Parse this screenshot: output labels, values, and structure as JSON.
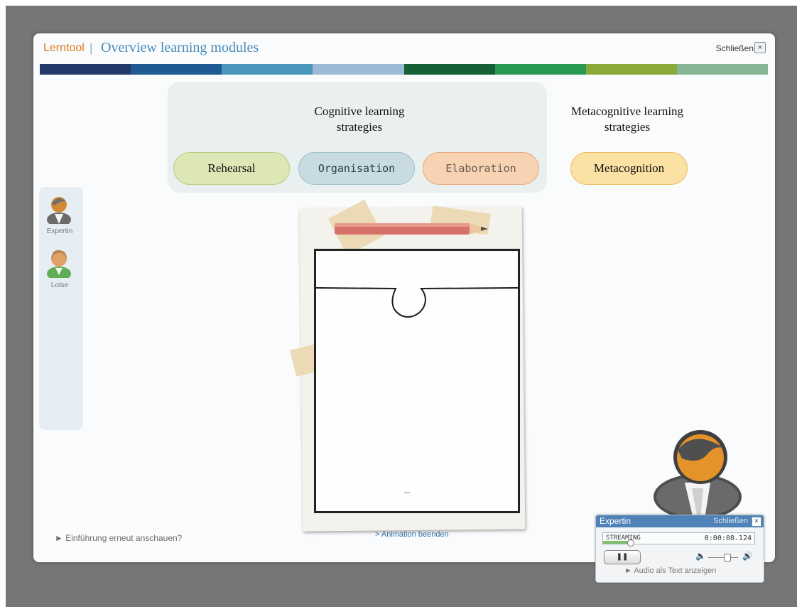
{
  "window": {
    "app_name": "Lerntool",
    "separator": "|",
    "title": "Overview learning modules",
    "close_label": "Schließen",
    "close_icon": "×"
  },
  "color_bar": [
    "#233a68",
    "#1f5a94",
    "#4a97bb",
    "#9abad8",
    "#175f35",
    "#2a9a53",
    "#8aa93a",
    "#86b594"
  ],
  "strategies": {
    "cognitive_heading": "Cognitive learning strategies",
    "metacognitive_heading": "Metacognitive learning strategies",
    "modules": [
      {
        "label": "Rehearsal",
        "color": "#dde7b6",
        "border": "#b9cc80",
        "text_color": "#111111"
      },
      {
        "label": "Organisation",
        "color": "#c8dbe2",
        "border": "#9fbfca",
        "text_color": "#2c3a47"
      },
      {
        "label": "Elaboration",
        "color": "#f8d3b3",
        "border": "#e7aa7f",
        "text_color": "#6b5a4d"
      },
      {
        "label": "Metacognition",
        "color": "#fbe1a3",
        "border": "#e9bd5d",
        "text_color": "#111111"
      }
    ]
  },
  "sidebar": {
    "items": [
      {
        "label": "Expertin",
        "icon": "expert-avatar-icon"
      },
      {
        "label": "Lotse",
        "icon": "guide-avatar-icon"
      }
    ]
  },
  "footer": {
    "intro_link": "► Einführung erneut anschauen?",
    "animation_link": "> Animation beenden"
  },
  "player": {
    "title": "Expertin",
    "close_label": "Schließen",
    "close_icon": "×",
    "status": "STREAMING",
    "time": "0:00:08.124",
    "progress": 0.18,
    "pause_icon": "❚❚",
    "volume": 0.65,
    "volume_low_icon": "🔈",
    "volume_high_icon": "🔊",
    "audio_text_link": "► Audio als Text anzeigen"
  }
}
